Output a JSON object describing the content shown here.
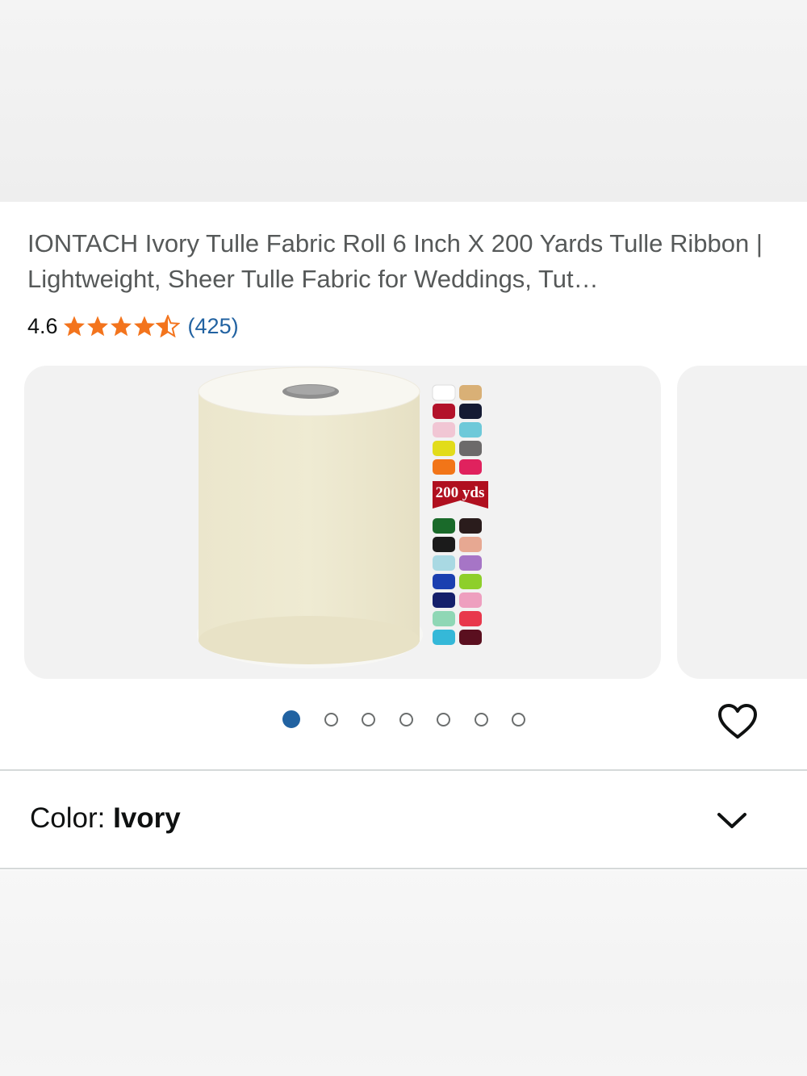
{
  "product": {
    "title": "IONTACH Ivory Tulle Fabric Roll 6 Inch X 200 Yards Tulle Ribbon | Lightweight, Sheer Tulle Fabric for Weddings, Tut…",
    "rating": "4.6",
    "stars": 4.6,
    "review_count": "(425)",
    "image_badge": "200 yds"
  },
  "carousel": {
    "total_images": 7,
    "active_index": 0
  },
  "variation": {
    "label": "Color: ",
    "value": "Ivory"
  },
  "icons": {
    "star": "star-icon",
    "wishlist": "heart-icon",
    "expand": "chevron-down-icon"
  },
  "colors": {
    "star": "#f3741d",
    "link": "#2162a1",
    "dot_active": "#2162a1"
  }
}
